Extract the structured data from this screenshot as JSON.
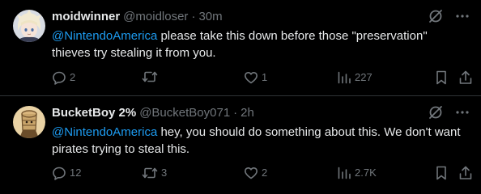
{
  "tweets": [
    {
      "display_name": "moidwinner",
      "handle": "@moidloser",
      "separator": "·",
      "time": "30m",
      "mention": "@NintendoAmerica",
      "text": " please take this down before those \"preservation\" thieves try stealing it from you.",
      "replies": "2",
      "reposts": "",
      "likes": "1",
      "views": "227"
    },
    {
      "display_name": "BucketBoy 2%",
      "handle": "@BucketBoy071",
      "separator": "·",
      "time": "2h",
      "mention": "@NintendoAmerica",
      "text": " hey, you should do something about this. We don't want pirates trying to steal this.",
      "replies": "12",
      "reposts": "3",
      "likes": "2",
      "views": "2.7K"
    }
  ],
  "icons": {
    "grok": "grok-icon",
    "more": "more-icon",
    "reply": "reply-icon",
    "repost": "repost-icon",
    "like": "like-icon",
    "views": "views-icon",
    "bookmark": "bookmark-icon",
    "share": "share-icon"
  },
  "colors": {
    "background": "#000000",
    "text": "#e7e9ea",
    "muted": "#71767b",
    "mention": "#1d9bf0",
    "divider": "#2f3336"
  }
}
